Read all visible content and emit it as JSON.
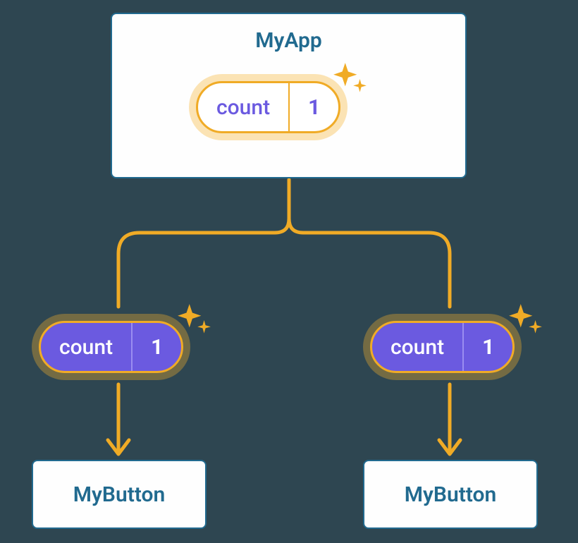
{
  "parent": {
    "title": "MyApp",
    "state": {
      "label": "count",
      "value": "1"
    }
  },
  "props": {
    "left": {
      "label": "count",
      "value": "1"
    },
    "right": {
      "label": "count",
      "value": "1"
    }
  },
  "children": {
    "left": {
      "title": "MyButton"
    },
    "right": {
      "title": "MyButton"
    }
  },
  "colors": {
    "accent": "#f0ab26",
    "prop": "#6b5ae0",
    "node": "#216a8f"
  }
}
